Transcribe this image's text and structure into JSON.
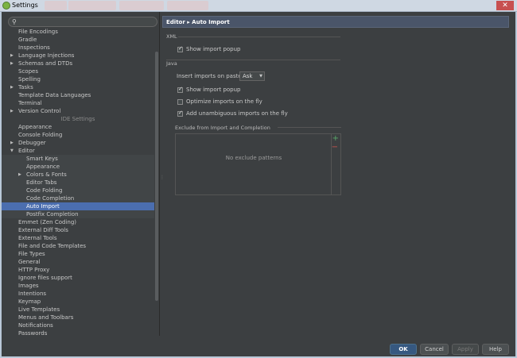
{
  "window": {
    "title": "Settings"
  },
  "search": {
    "placeholder": ""
  },
  "tree": [
    {
      "label": "File Encodings",
      "indent": 0
    },
    {
      "label": "Gradle",
      "indent": 0
    },
    {
      "label": "Inspections",
      "indent": 0
    },
    {
      "label": "Language Injections",
      "indent": 0,
      "arrow": "right"
    },
    {
      "label": "Schemas and DTDs",
      "indent": 0,
      "arrow": "right"
    },
    {
      "label": "Scopes",
      "indent": 0
    },
    {
      "label": "Spelling",
      "indent": 0
    },
    {
      "label": "Tasks",
      "indent": 0,
      "arrow": "right"
    },
    {
      "label": "Template Data Languages",
      "indent": 0
    },
    {
      "label": "Terminal",
      "indent": 0
    },
    {
      "label": "Version Control",
      "indent": 0,
      "arrow": "right"
    },
    {
      "label": "IDE Settings",
      "header": true
    },
    {
      "label": "Appearance",
      "indent": 0
    },
    {
      "label": "Console Folding",
      "indent": 0
    },
    {
      "label": "Debugger",
      "indent": 0,
      "arrow": "right"
    },
    {
      "label": "Editor",
      "indent": 0,
      "arrow": "down"
    },
    {
      "label": "Smart Keys",
      "indent": 1
    },
    {
      "label": "Appearance",
      "indent": 1
    },
    {
      "label": "Colors & Fonts",
      "indent": 1,
      "arrow": "right"
    },
    {
      "label": "Editor Tabs",
      "indent": 1
    },
    {
      "label": "Code Folding",
      "indent": 1
    },
    {
      "label": "Code Completion",
      "indent": 1
    },
    {
      "label": "Auto Import",
      "indent": 1,
      "selected": true
    },
    {
      "label": "Postfix Completion",
      "indent": 1
    },
    {
      "label": "Emmet (Zen Coding)",
      "indent": 0
    },
    {
      "label": "External Diff Tools",
      "indent": 0
    },
    {
      "label": "External Tools",
      "indent": 0
    },
    {
      "label": "File and Code Templates",
      "indent": 0
    },
    {
      "label": "File Types",
      "indent": 0
    },
    {
      "label": "General",
      "indent": 0
    },
    {
      "label": "HTTP Proxy",
      "indent": 0
    },
    {
      "label": "Ignore files support",
      "indent": 0
    },
    {
      "label": "Images",
      "indent": 0
    },
    {
      "label": "Intentions",
      "indent": 0
    },
    {
      "label": "Keymap",
      "indent": 0
    },
    {
      "label": "Live Templates",
      "indent": 0
    },
    {
      "label": "Menus and Toolbars",
      "indent": 0
    },
    {
      "label": "Notifications",
      "indent": 0
    },
    {
      "label": "Passwords",
      "indent": 0
    }
  ],
  "content": {
    "breadcrumb": "Editor ▸ Auto Import",
    "xml_section": "XML",
    "xml_show_popup": {
      "label": "Show import popup",
      "checked": true
    },
    "java_section": "Java",
    "insert_label": "Insert imports on paste:",
    "insert_value": "Ask",
    "java_show_popup": {
      "label": "Show import popup",
      "checked": true
    },
    "optimize": {
      "label": "Optimize imports on the fly",
      "checked": false
    },
    "unambiguous": {
      "label": "Add unambiguous imports on the fly",
      "checked": true
    },
    "exclude_title": "Exclude from Import and Completion",
    "exclude_empty": "No exclude patterns"
  },
  "buttons": {
    "ok": "OK",
    "cancel": "Cancel",
    "apply": "Apply",
    "help": "Help"
  },
  "colors": {
    "selection": "#4b6eaf",
    "background": "#3c3f41",
    "primary_button": "#365880"
  }
}
